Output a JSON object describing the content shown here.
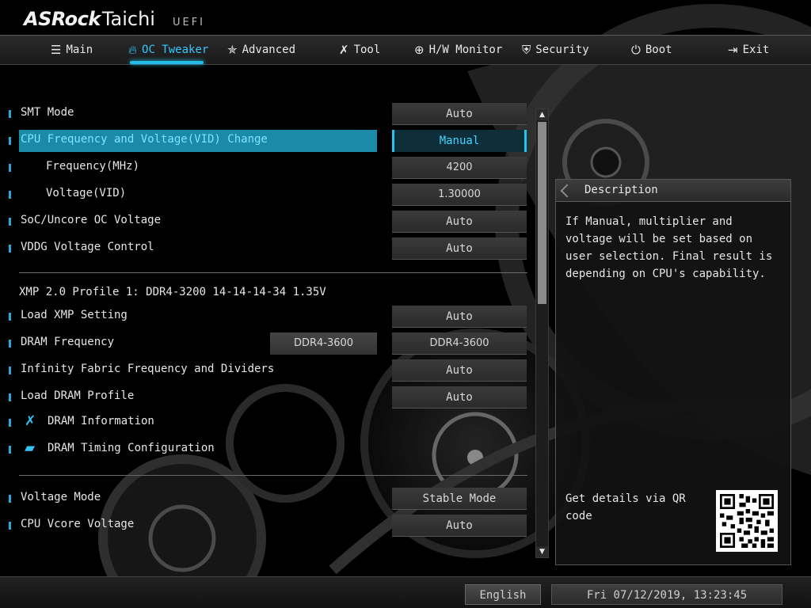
{
  "header": {
    "brand": "ASRock",
    "model": "Taichi",
    "firmware": "UEFI"
  },
  "tabs": [
    {
      "label": "Main",
      "icon": "list-icon",
      "active": false
    },
    {
      "label": "OC Tweaker",
      "icon": "flame-icon",
      "active": true
    },
    {
      "label": "Advanced",
      "icon": "star-icon",
      "active": false
    },
    {
      "label": "Tool",
      "icon": "tools-icon",
      "active": false
    },
    {
      "label": "H/W Monitor",
      "icon": "crosshair-icon",
      "active": false
    },
    {
      "label": "Security",
      "icon": "shield-icon",
      "active": false
    },
    {
      "label": "Boot",
      "icon": "power-icon",
      "active": false
    },
    {
      "label": "Exit",
      "icon": "exit-icon",
      "active": false
    }
  ],
  "settings": {
    "smt_mode": {
      "label": "SMT Mode",
      "value": "Auto"
    },
    "cpu_freq_vid": {
      "label": "CPU Frequency and Voltage(VID) Change",
      "value": "Manual"
    },
    "frequency": {
      "label": "Frequency(MHz)",
      "value": "4200"
    },
    "voltage_vid": {
      "label": "Voltage(VID)",
      "value": "1.30000"
    },
    "soc_uncore": {
      "label": "SoC/Uncore OC Voltage",
      "value": "Auto"
    },
    "vddg": {
      "label": "VDDG Voltage Control",
      "value": "Auto"
    },
    "xmp_info": "XMP 2.0 Profile 1: DDR4-3200 14-14-14-34 1.35V",
    "load_xmp": {
      "label": "Load XMP Setting",
      "value": "Auto"
    },
    "dram_freq": {
      "label": "DRAM Frequency",
      "current": "DDR4-3600",
      "value": "DDR4-3600"
    },
    "infinity_fabric": {
      "label": "Infinity Fabric Frequency and Dividers",
      "value": "Auto"
    },
    "load_dram_profile": {
      "label": "Load DRAM Profile",
      "value": "Auto"
    },
    "dram_info": {
      "label": "DRAM Information",
      "icon": "tools-icon"
    },
    "dram_timing": {
      "label": "DRAM Timing Configuration",
      "icon": "folder-icon"
    },
    "voltage_mode": {
      "label": "Voltage Mode",
      "value": "Stable Mode"
    },
    "cpu_vcore": {
      "label": "CPU Vcore Voltage",
      "value": "Auto"
    }
  },
  "description": {
    "title": "Description",
    "text": "If Manual, multiplier and voltage will be set based on user selection. Final result is depending on CPU's capability.",
    "qr_text": "Get details via QR code"
  },
  "footer": {
    "language": "English",
    "datetime": "Fri 07/12/2019, 13:23:45"
  },
  "colors": {
    "accent": "#24bde8",
    "highlight": "#1a8aa8",
    "manual_text": "#42d4ff"
  }
}
